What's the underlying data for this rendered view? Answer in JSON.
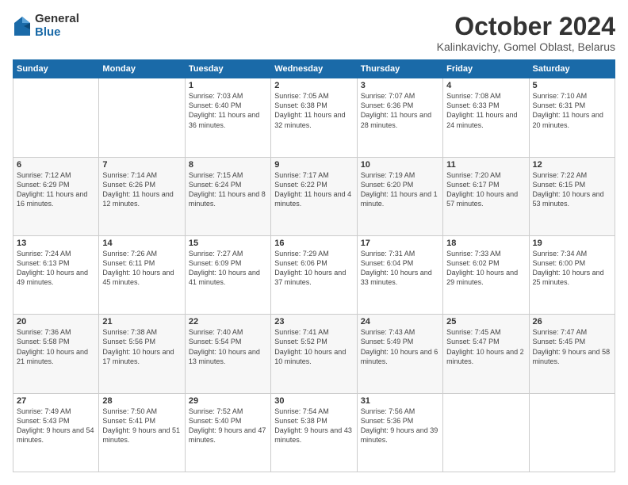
{
  "logo": {
    "general": "General",
    "blue": "Blue"
  },
  "title": {
    "month": "October 2024",
    "location": "Kalinkavichy, Gomel Oblast, Belarus"
  },
  "days_of_week": [
    "Sunday",
    "Monday",
    "Tuesday",
    "Wednesday",
    "Thursday",
    "Friday",
    "Saturday"
  ],
  "weeks": [
    [
      {
        "day": "",
        "sunrise": "",
        "sunset": "",
        "daylight": ""
      },
      {
        "day": "",
        "sunrise": "",
        "sunset": "",
        "daylight": ""
      },
      {
        "day": "1",
        "sunrise": "Sunrise: 7:03 AM",
        "sunset": "Sunset: 6:40 PM",
        "daylight": "Daylight: 11 hours and 36 minutes."
      },
      {
        "day": "2",
        "sunrise": "Sunrise: 7:05 AM",
        "sunset": "Sunset: 6:38 PM",
        "daylight": "Daylight: 11 hours and 32 minutes."
      },
      {
        "day": "3",
        "sunrise": "Sunrise: 7:07 AM",
        "sunset": "Sunset: 6:36 PM",
        "daylight": "Daylight: 11 hours and 28 minutes."
      },
      {
        "day": "4",
        "sunrise": "Sunrise: 7:08 AM",
        "sunset": "Sunset: 6:33 PM",
        "daylight": "Daylight: 11 hours and 24 minutes."
      },
      {
        "day": "5",
        "sunrise": "Sunrise: 7:10 AM",
        "sunset": "Sunset: 6:31 PM",
        "daylight": "Daylight: 11 hours and 20 minutes."
      }
    ],
    [
      {
        "day": "6",
        "sunrise": "Sunrise: 7:12 AM",
        "sunset": "Sunset: 6:29 PM",
        "daylight": "Daylight: 11 hours and 16 minutes."
      },
      {
        "day": "7",
        "sunrise": "Sunrise: 7:14 AM",
        "sunset": "Sunset: 6:26 PM",
        "daylight": "Daylight: 11 hours and 12 minutes."
      },
      {
        "day": "8",
        "sunrise": "Sunrise: 7:15 AM",
        "sunset": "Sunset: 6:24 PM",
        "daylight": "Daylight: 11 hours and 8 minutes."
      },
      {
        "day": "9",
        "sunrise": "Sunrise: 7:17 AM",
        "sunset": "Sunset: 6:22 PM",
        "daylight": "Daylight: 11 hours and 4 minutes."
      },
      {
        "day": "10",
        "sunrise": "Sunrise: 7:19 AM",
        "sunset": "Sunset: 6:20 PM",
        "daylight": "Daylight: 11 hours and 1 minute."
      },
      {
        "day": "11",
        "sunrise": "Sunrise: 7:20 AM",
        "sunset": "Sunset: 6:17 PM",
        "daylight": "Daylight: 10 hours and 57 minutes."
      },
      {
        "day": "12",
        "sunrise": "Sunrise: 7:22 AM",
        "sunset": "Sunset: 6:15 PM",
        "daylight": "Daylight: 10 hours and 53 minutes."
      }
    ],
    [
      {
        "day": "13",
        "sunrise": "Sunrise: 7:24 AM",
        "sunset": "Sunset: 6:13 PM",
        "daylight": "Daylight: 10 hours and 49 minutes."
      },
      {
        "day": "14",
        "sunrise": "Sunrise: 7:26 AM",
        "sunset": "Sunset: 6:11 PM",
        "daylight": "Daylight: 10 hours and 45 minutes."
      },
      {
        "day": "15",
        "sunrise": "Sunrise: 7:27 AM",
        "sunset": "Sunset: 6:09 PM",
        "daylight": "Daylight: 10 hours and 41 minutes."
      },
      {
        "day": "16",
        "sunrise": "Sunrise: 7:29 AM",
        "sunset": "Sunset: 6:06 PM",
        "daylight": "Daylight: 10 hours and 37 minutes."
      },
      {
        "day": "17",
        "sunrise": "Sunrise: 7:31 AM",
        "sunset": "Sunset: 6:04 PM",
        "daylight": "Daylight: 10 hours and 33 minutes."
      },
      {
        "day": "18",
        "sunrise": "Sunrise: 7:33 AM",
        "sunset": "Sunset: 6:02 PM",
        "daylight": "Daylight: 10 hours and 29 minutes."
      },
      {
        "day": "19",
        "sunrise": "Sunrise: 7:34 AM",
        "sunset": "Sunset: 6:00 PM",
        "daylight": "Daylight: 10 hours and 25 minutes."
      }
    ],
    [
      {
        "day": "20",
        "sunrise": "Sunrise: 7:36 AM",
        "sunset": "Sunset: 5:58 PM",
        "daylight": "Daylight: 10 hours and 21 minutes."
      },
      {
        "day": "21",
        "sunrise": "Sunrise: 7:38 AM",
        "sunset": "Sunset: 5:56 PM",
        "daylight": "Daylight: 10 hours and 17 minutes."
      },
      {
        "day": "22",
        "sunrise": "Sunrise: 7:40 AM",
        "sunset": "Sunset: 5:54 PM",
        "daylight": "Daylight: 10 hours and 13 minutes."
      },
      {
        "day": "23",
        "sunrise": "Sunrise: 7:41 AM",
        "sunset": "Sunset: 5:52 PM",
        "daylight": "Daylight: 10 hours and 10 minutes."
      },
      {
        "day": "24",
        "sunrise": "Sunrise: 7:43 AM",
        "sunset": "Sunset: 5:49 PM",
        "daylight": "Daylight: 10 hours and 6 minutes."
      },
      {
        "day": "25",
        "sunrise": "Sunrise: 7:45 AM",
        "sunset": "Sunset: 5:47 PM",
        "daylight": "Daylight: 10 hours and 2 minutes."
      },
      {
        "day": "26",
        "sunrise": "Sunrise: 7:47 AM",
        "sunset": "Sunset: 5:45 PM",
        "daylight": "Daylight: 9 hours and 58 minutes."
      }
    ],
    [
      {
        "day": "27",
        "sunrise": "Sunrise: 7:49 AM",
        "sunset": "Sunset: 5:43 PM",
        "daylight": "Daylight: 9 hours and 54 minutes."
      },
      {
        "day": "28",
        "sunrise": "Sunrise: 7:50 AM",
        "sunset": "Sunset: 5:41 PM",
        "daylight": "Daylight: 9 hours and 51 minutes."
      },
      {
        "day": "29",
        "sunrise": "Sunrise: 7:52 AM",
        "sunset": "Sunset: 5:40 PM",
        "daylight": "Daylight: 9 hours and 47 minutes."
      },
      {
        "day": "30",
        "sunrise": "Sunrise: 7:54 AM",
        "sunset": "Sunset: 5:38 PM",
        "daylight": "Daylight: 9 hours and 43 minutes."
      },
      {
        "day": "31",
        "sunrise": "Sunrise: 7:56 AM",
        "sunset": "Sunset: 5:36 PM",
        "daylight": "Daylight: 9 hours and 39 minutes."
      },
      {
        "day": "",
        "sunrise": "",
        "sunset": "",
        "daylight": ""
      },
      {
        "day": "",
        "sunrise": "",
        "sunset": "",
        "daylight": ""
      }
    ]
  ]
}
